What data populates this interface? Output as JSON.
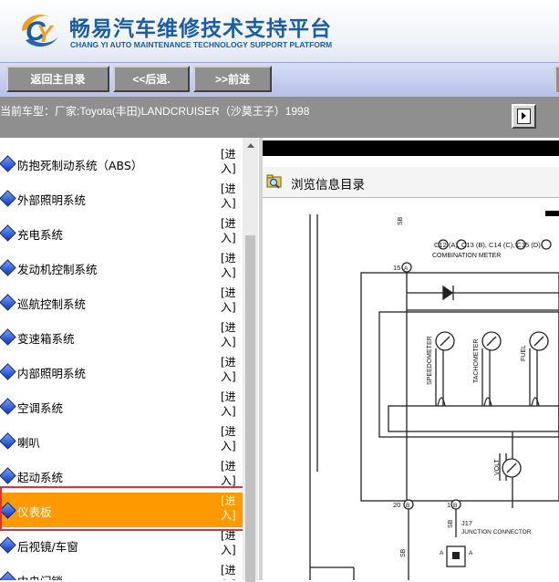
{
  "header": {
    "title_cn": "畅易汽车维修技术支持平台",
    "title_en": "CHANG YI AUTO MAINTENANCE TECHNOLOGY SUPPORT PLATFORM"
  },
  "nav": {
    "home": "返回主目录",
    "back": "<<后退.",
    "forward": ">>前进"
  },
  "model": {
    "text": "当前车型：厂家:Toyota(丰田)LANDCRUISER（沙莫王子）1998"
  },
  "menu": {
    "items": [
      {
        "label": "防抱死制动系统（ABS）",
        "enter": "[进入]",
        "active": false
      },
      {
        "label": "外部照明系统",
        "enter": "[进入]",
        "active": false
      },
      {
        "label": "充电系统",
        "enter": "[进入]",
        "active": false
      },
      {
        "label": "发动机控制系统",
        "enter": "[进入]",
        "active": false
      },
      {
        "label": "巡航控制系统",
        "enter": "[进入]",
        "active": false
      },
      {
        "label": "变速箱系统",
        "enter": "[进入]",
        "active": false
      },
      {
        "label": "内部照明系统",
        "enter": "[进入]",
        "active": false
      },
      {
        "label": "空调系统",
        "enter": "[进入]",
        "active": false
      },
      {
        "label": "喇叭",
        "enter": "[进入]",
        "active": false
      },
      {
        "label": "起动系统",
        "enter": "[进入]",
        "active": false
      },
      {
        "label": "仪表板",
        "enter": "[进入]",
        "active": true
      },
      {
        "label": "后视镜/车窗",
        "enter": "[进入]",
        "active": false
      },
      {
        "label": "中央门锁",
        "enter": "[进入]",
        "active": false
      }
    ]
  },
  "document": {
    "title": "浏览信息目录"
  },
  "diagram": {
    "connectors": "C12 (A), C13 (B), C14 (C), C15 (D)",
    "combination_meter": "COMBINATION METER",
    "speedometer": "SPEEDOMETER",
    "tachometer": "TACHOMETER",
    "fuel": "FUEL",
    "volt": "VOLT",
    "pin_15a": "15",
    "pin_15a_tag": "A",
    "pin_20b": "20",
    "pin_20b_tag": "B",
    "pin_1b": "1",
    "pin_1b_tag": "B",
    "sb_top": "SB",
    "sb_mid": "SB",
    "sb_bottom": "SB",
    "j17": "J17",
    "junction_connector": "JUNCTION CONNECTOR",
    "a1": "A",
    "a2": "A"
  }
}
